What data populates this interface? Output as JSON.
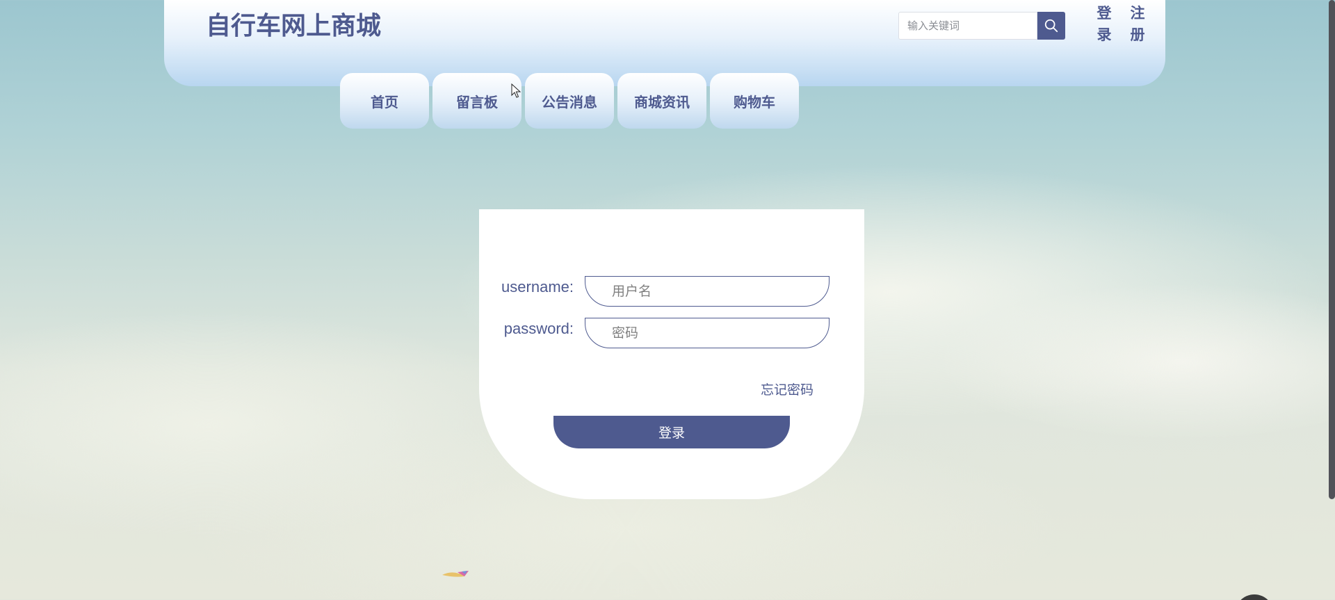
{
  "header": {
    "site_title": "自行车网上商城",
    "search": {
      "placeholder": "输入关键词"
    },
    "auth": {
      "login": "登录",
      "register": "注册"
    }
  },
  "nav": {
    "items": [
      {
        "label": "首页"
      },
      {
        "label": "留言板"
      },
      {
        "label": "公告消息"
      },
      {
        "label": "商城资讯"
      },
      {
        "label": "购物车"
      }
    ]
  },
  "login_form": {
    "username_label": "username:",
    "username_placeholder": "用户名",
    "password_label": "password:",
    "password_placeholder": "密码",
    "forgot_password": "忘记密码",
    "submit_label": "登录"
  },
  "colors": {
    "accent": "#4e5a8f",
    "header_gradient_top": "#ffffff",
    "header_gradient_bottom": "#b8d6f0"
  },
  "icons": {
    "search_button": "search-icon"
  }
}
